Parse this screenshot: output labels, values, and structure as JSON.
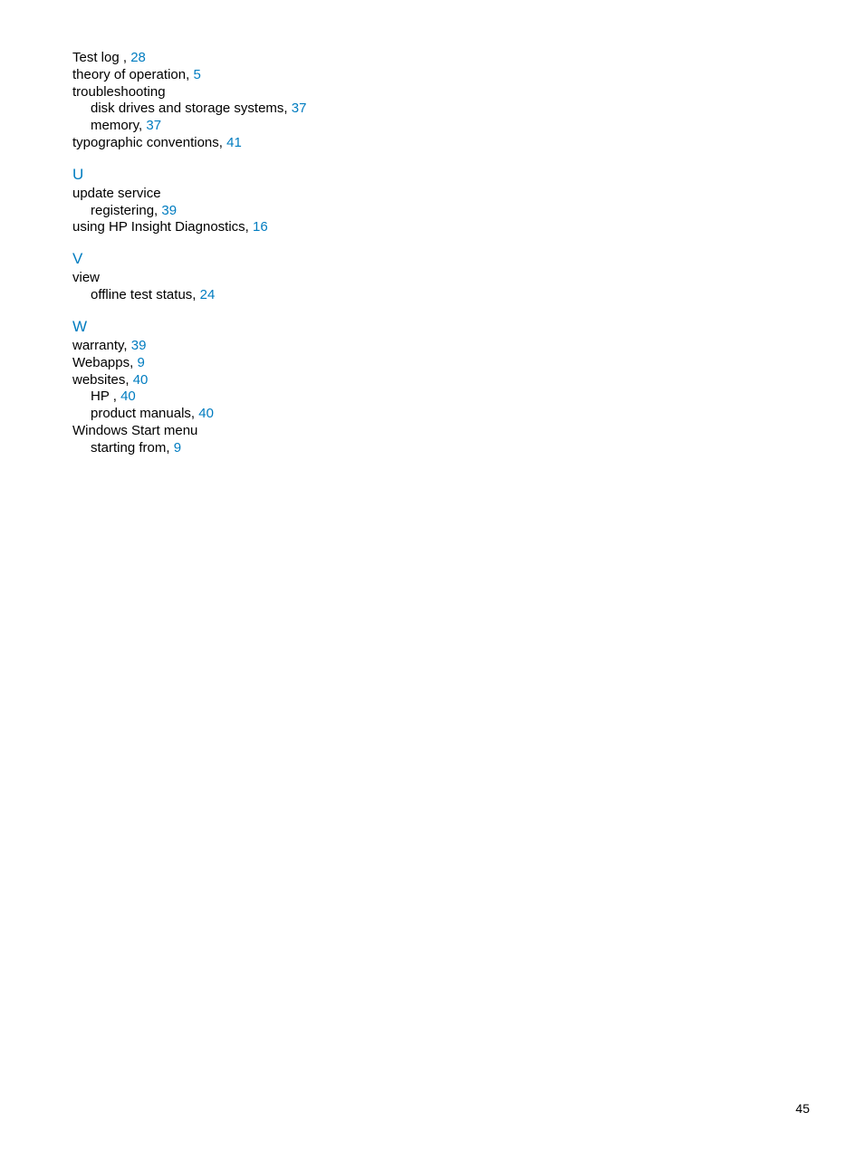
{
  "accent_color": "#007cc0",
  "t": {
    "test_log": "Test log ,",
    "test_log_pg": "28",
    "theory": "theory of operation,",
    "theory_pg": "5",
    "troubleshooting": "troubleshooting",
    "ts_disk": "disk drives and storage systems,",
    "ts_disk_pg": "37",
    "ts_memory": "memory,",
    "ts_memory_pg": "37",
    "typographic": "typographic conventions,",
    "typographic_pg": "41"
  },
  "u": {
    "heading": "U",
    "update_service": "update service",
    "registering": "registering,",
    "registering_pg": "39",
    "using_insight": "using HP Insight Diagnostics,",
    "using_insight_pg": "16"
  },
  "v": {
    "heading": "V",
    "view": "view",
    "offline_test_status": "offline test status,",
    "offline_test_status_pg": "24"
  },
  "w": {
    "heading": "W",
    "warranty": "warranty,",
    "warranty_pg": "39",
    "webapps": "Webapps,",
    "webapps_pg": "9",
    "websites": "websites,",
    "websites_pg": "40",
    "hp": "HP ,",
    "hp_pg": "40",
    "product_manuals": "product manuals,",
    "product_manuals_pg": "40",
    "windows_start": "Windows Start menu",
    "starting_from": "starting from,",
    "starting_from_pg": "9"
  },
  "page_number": "45"
}
